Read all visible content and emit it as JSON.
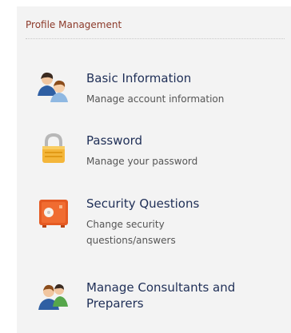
{
  "profile_management": {
    "section_title": "Profile Management",
    "items": [
      {
        "title": "Basic Information",
        "description": "Manage account information",
        "icon": "users-icon"
      },
      {
        "title": "Password",
        "description": "Manage your password",
        "icon": "padlock-icon"
      },
      {
        "title": "Security Questions",
        "description": "Change security questions/answers",
        "icon": "safe-icon"
      },
      {
        "title": "Manage Consultants and Preparers",
        "description": "",
        "icon": "people-icon"
      }
    ],
    "colors": {
      "panel_bg": "#f3f3f3",
      "section_title": "#8c3a2a",
      "item_title": "#1f2f57",
      "item_desc": "#555555"
    }
  }
}
